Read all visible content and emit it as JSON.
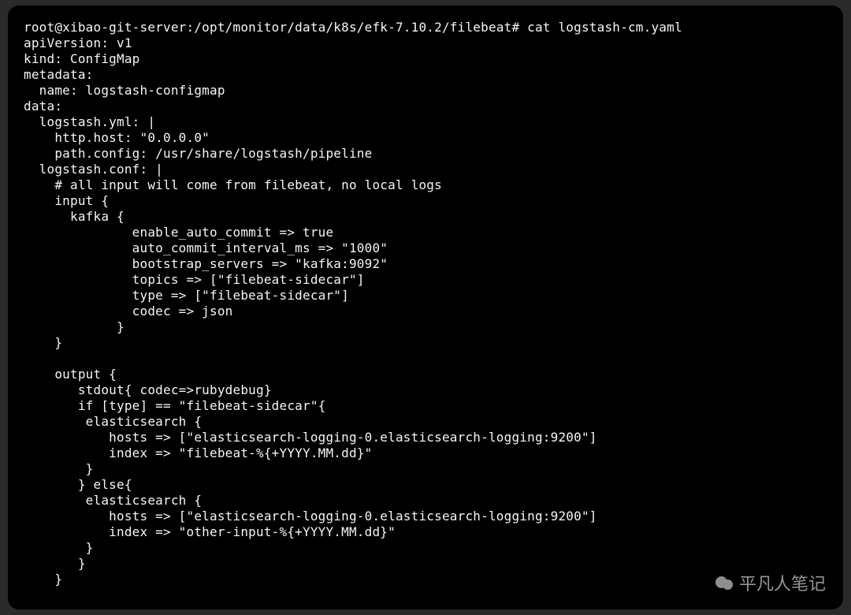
{
  "terminal": {
    "prompt": "root@xibao-git-server:/opt/monitor/data/k8s/efk-7.10.2/filebeat# ",
    "command": "cat logstash-cm.yaml",
    "lines": [
      "apiVersion: v1",
      "kind: ConfigMap",
      "metadata:",
      "  name: logstash-configmap",
      "data:",
      "  logstash.yml: |",
      "    http.host: \"0.0.0.0\"",
      "    path.config: /usr/share/logstash/pipeline",
      "  logstash.conf: |",
      "    # all input will come from filebeat, no local logs",
      "    input {",
      "      kafka {",
      "              enable_auto_commit => true",
      "              auto_commit_interval_ms => \"1000\"",
      "              bootstrap_servers => \"kafka:9092\"",
      "              topics => [\"filebeat-sidecar\"]",
      "              type => [\"filebeat-sidecar\"]",
      "              codec => json",
      "            }",
      "    }",
      "",
      "    output {",
      "       stdout{ codec=>rubydebug}",
      "       if [type] == \"filebeat-sidecar\"{",
      "        elasticsearch {",
      "           hosts => [\"elasticsearch-logging-0.elasticsearch-logging:9200\"]",
      "           index => \"filebeat-%{+YYYY.MM.dd}\"",
      "        }",
      "       } else{",
      "        elasticsearch {",
      "           hosts => [\"elasticsearch-logging-0.elasticsearch-logging:9200\"]",
      "           index => \"other-input-%{+YYYY.MM.dd}\"",
      "        }",
      "       }",
      "    }"
    ]
  },
  "watermark": {
    "text": "平凡人笔记"
  }
}
